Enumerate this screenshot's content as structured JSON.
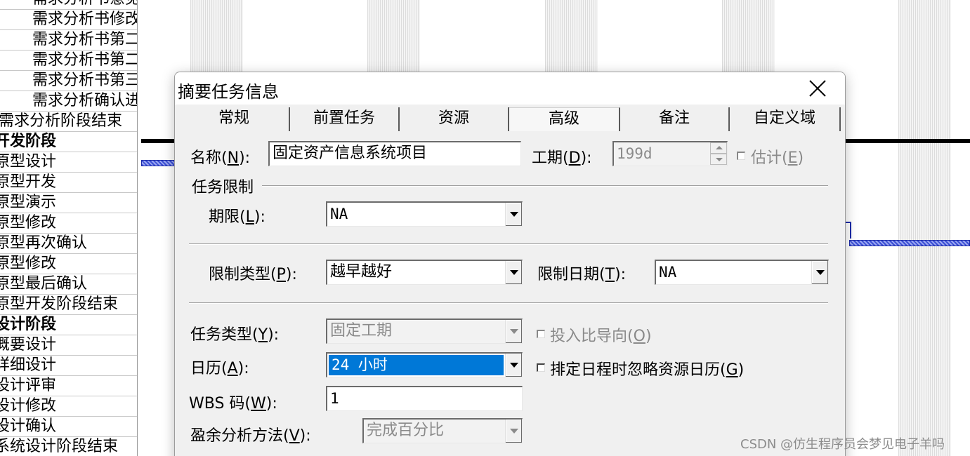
{
  "task_list": [
    {
      "name": "需求分析书意见",
      "bold": false
    },
    {
      "name": "需求分析书修改",
      "bold": false
    },
    {
      "name": "需求分析书第二",
      "bold": false
    },
    {
      "name": "需求分析书第二",
      "bold": false
    },
    {
      "name": "需求分析书第三",
      "bold": false
    },
    {
      "name": "需求分析确认进",
      "bold": false
    },
    {
      "name": "需求分析阶段结束",
      "bold": false
    },
    {
      "name": "开发阶段",
      "bold": true
    },
    {
      "name": "原型设计",
      "bold": false
    },
    {
      "name": "原型开发",
      "bold": false
    },
    {
      "name": "原型演示",
      "bold": false
    },
    {
      "name": "原型修改",
      "bold": false
    },
    {
      "name": "原型再次确认",
      "bold": false
    },
    {
      "name": "原型修改",
      "bold": false
    },
    {
      "name": "原型最后确认",
      "bold": false
    },
    {
      "name": "原型开发阶段结束",
      "bold": false
    },
    {
      "name": "设计阶段",
      "bold": true
    },
    {
      "name": "概要设计",
      "bold": false
    },
    {
      "name": "详细设计",
      "bold": false
    },
    {
      "name": "设计评审",
      "bold": false
    },
    {
      "name": "设计修改",
      "bold": false
    },
    {
      "name": "设计确认",
      "bold": false
    },
    {
      "name": "系统设计阶段结束",
      "bold": false
    }
  ],
  "dialog": {
    "title": "摘要任务信息",
    "tabs": [
      "常规",
      "前置任务",
      "资源",
      "高级",
      "备注",
      "自定义域"
    ],
    "active_tab": "高级",
    "name": {
      "label": "名称",
      "key": "N",
      "value": "固定资产信息系统项目"
    },
    "duration": {
      "label": "工期",
      "key": "D",
      "value": "199d",
      "disabled": true
    },
    "estimated": {
      "label": "估计",
      "key": "E",
      "checked": false,
      "disabled": true
    },
    "constraint_group": "任务限制",
    "deadline": {
      "label": "期限",
      "key": "L",
      "value": "NA"
    },
    "constraint_type": {
      "label": "限制类型",
      "key": "P",
      "value": "越早越好"
    },
    "constraint_date": {
      "label": "限制日期",
      "key": "T",
      "value": "NA"
    },
    "task_type": {
      "label": "任务类型",
      "key": "Y",
      "value": "固定工期",
      "disabled": true
    },
    "effort_driven": {
      "label": "投入比导向",
      "key": "O",
      "checked": false,
      "disabled": true
    },
    "calendar": {
      "label": "日历",
      "key": "A",
      "value": "24 小时"
    },
    "ignore_resource_calendar": {
      "label": "排定日程时忽略资源日历",
      "key": "G",
      "checked": false
    },
    "wbs": {
      "label": "WBS 码",
      "key": "W",
      "value": "1"
    },
    "earned_value": {
      "label": "盈余分析方法",
      "key": "V",
      "value": "完成百分比",
      "disabled": true
    }
  },
  "watermark": "CSDN @仿生程序员会梦见电子羊吗",
  "colors": {
    "selection": "#0078d7",
    "gantt_bar": "#3b4fd6",
    "dialog_bg": "#f0f0f0"
  }
}
